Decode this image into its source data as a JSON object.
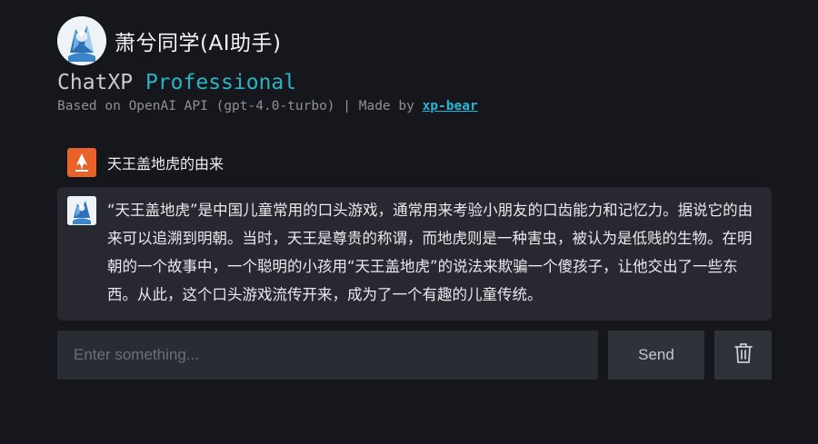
{
  "app": {
    "title": "萧兮同学(AI助手)",
    "brand_name": "ChatXP",
    "brand_edition": "Professional",
    "subtitle_prefix": "Based on OpenAI API (gpt-4.0-turbo) | Made by ",
    "author_link": "xp-bear"
  },
  "conversation": {
    "user_message": "天王盖地虎的由来",
    "assistant_reply": "“天王盖地虎”是中国儿童常用的口头游戏，通常用来考验小朋友的口齿能力和记忆力。据说它的由来可以追溯到明朝。当时，天王是尊贵的称谓，而地虎则是一种害虫，被认为是低贱的生物。在明朝的一个故事中，一个聪明的小孩用“天王盖地虎”的说法来欺骗一个傻孩子，让他交出了一些东西。从此，这个口头游戏流传开来，成为了一个有趣的儿童传统。"
  },
  "composer": {
    "placeholder": "Enter something...",
    "send_label": "Send",
    "clear_icon": "trash-icon"
  },
  "colors": {
    "background": "#16171d",
    "accent": "#2bb3c4",
    "link": "#25b6d9",
    "user_icon": "#e8622a",
    "reply_bg": "#272830"
  }
}
